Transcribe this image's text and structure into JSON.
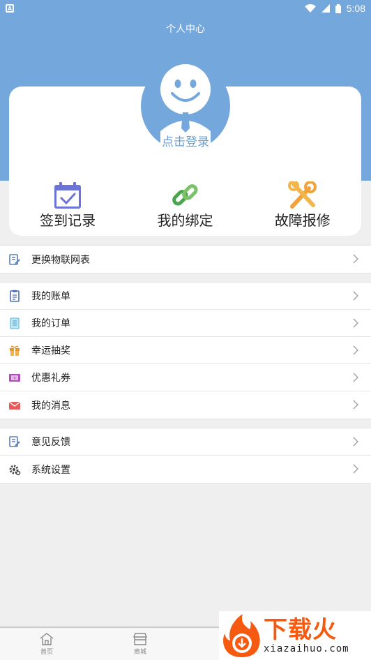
{
  "status_bar": {
    "time": "5:08"
  },
  "header": {
    "title": "个人中心"
  },
  "profile": {
    "login_text": "点击登录"
  },
  "quick_actions": [
    {
      "label": "签到记录",
      "icon": "calendar-check-icon"
    },
    {
      "label": "我的绑定",
      "icon": "link-icon"
    },
    {
      "label": "故障报修",
      "icon": "wrench-icon"
    }
  ],
  "menu_groups": [
    [
      {
        "label": "更换物联网表",
        "icon": "edit-doc-icon"
      }
    ],
    [
      {
        "label": "我的账单",
        "icon": "bill-icon"
      },
      {
        "label": "我的订单",
        "icon": "order-icon"
      },
      {
        "label": "幸运抽奖",
        "icon": "gift-icon"
      },
      {
        "label": "优惠礼券",
        "icon": "coupon-icon"
      },
      {
        "label": "我的消息",
        "icon": "mail-icon"
      }
    ],
    [
      {
        "label": "意见反馈",
        "icon": "feedback-icon"
      },
      {
        "label": "系统设置",
        "icon": "settings-icon"
      }
    ]
  ],
  "bottom_nav": [
    {
      "label": "首页",
      "icon": "home-icon"
    },
    {
      "label": "商城",
      "icon": "store-icon"
    }
  ],
  "watermark": {
    "title": "下载火",
    "subtitle": "xiazaihuo.com"
  },
  "colors": {
    "header": "#74a7dc",
    "accent": "#6a9fd6",
    "background": "#efefef"
  }
}
